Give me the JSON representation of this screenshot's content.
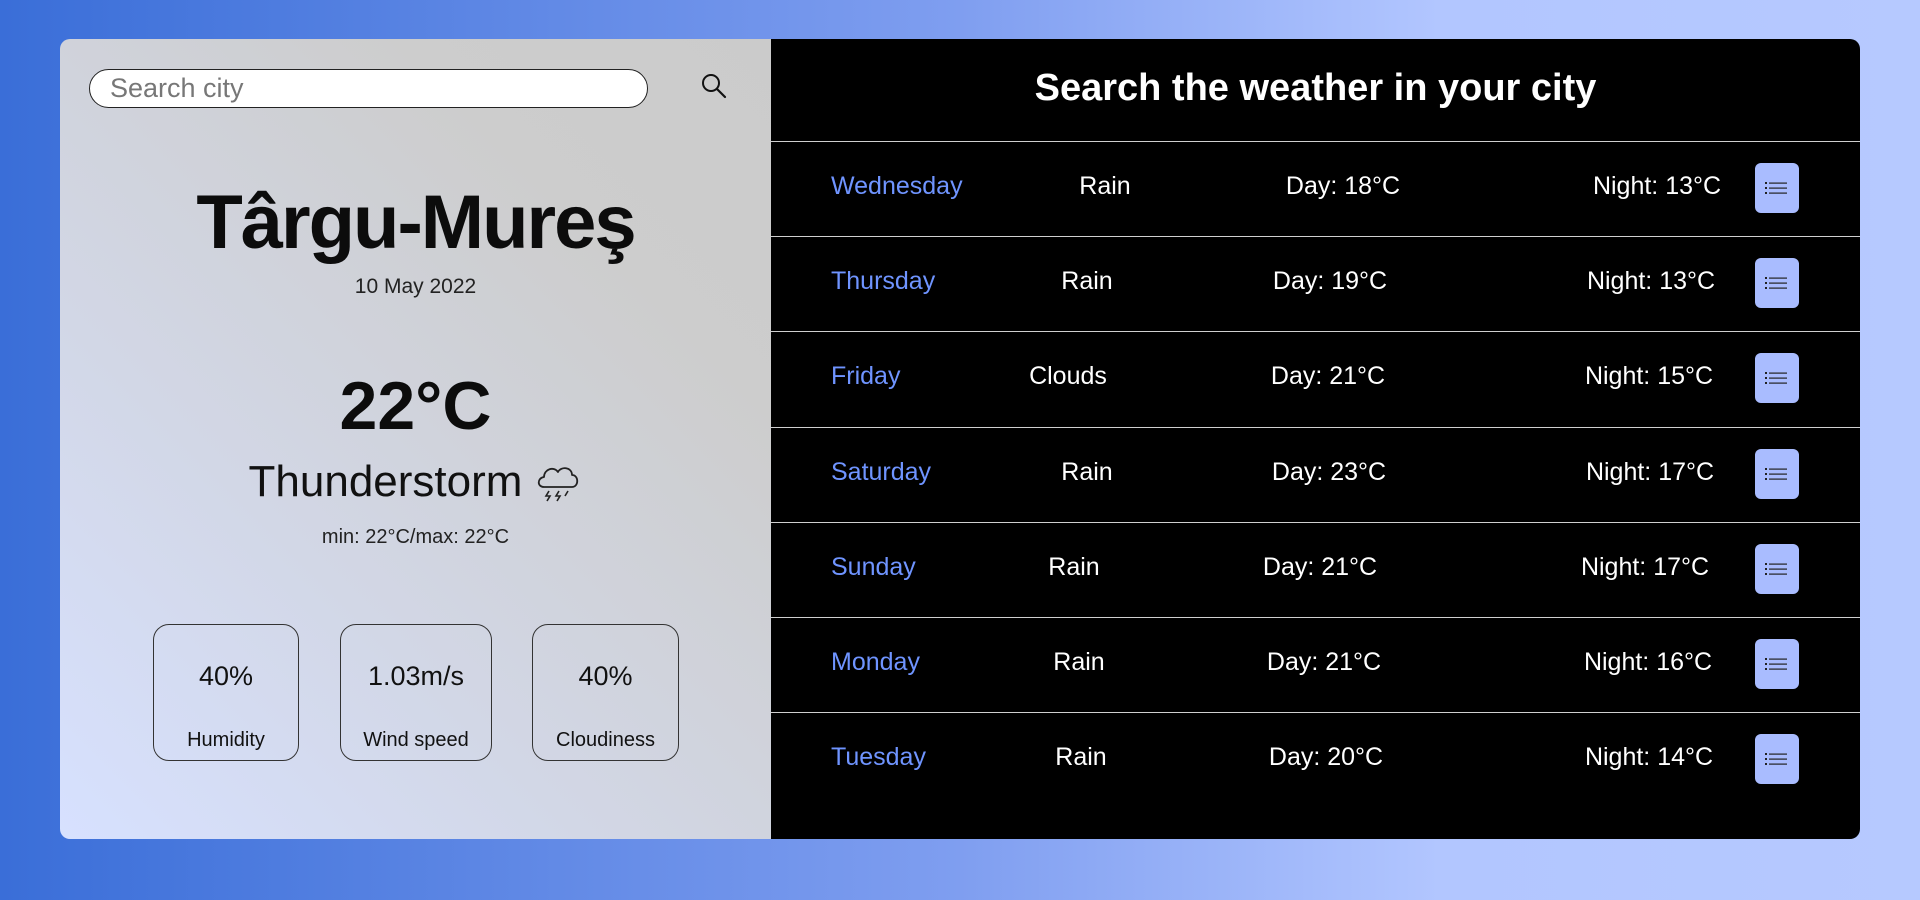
{
  "search": {
    "placeholder": "Search city",
    "value": ""
  },
  "current": {
    "city": "Târgu-Mureş",
    "date": "10 May 2022",
    "temperature": "22°C",
    "condition": "Thunderstorm",
    "condition_icon": "thunderstorm-cloud-icon",
    "minmax": "min: 22°C/max: 22°C"
  },
  "stats": [
    {
      "value": "40%",
      "label": "Humidity"
    },
    {
      "value": "1.03m/s",
      "label": "Wind speed"
    },
    {
      "value": "40%",
      "label": "Cloudiness"
    }
  ],
  "forecast": {
    "title": "Search the weather in your city",
    "days": [
      {
        "day": "Wednesday",
        "weather": "Rain",
        "day_temp": "Day: 18°C",
        "night_temp": "Night: 13°C"
      },
      {
        "day": "Thursday",
        "weather": "Rain",
        "day_temp": "Day: 19°C",
        "night_temp": "Night: 13°C"
      },
      {
        "day": "Friday",
        "weather": "Clouds",
        "day_temp": "Day: 21°C",
        "night_temp": "Night: 15°C"
      },
      {
        "day": "Saturday",
        "weather": "Rain",
        "day_temp": "Day: 23°C",
        "night_temp": "Night: 17°C"
      },
      {
        "day": "Sunday",
        "weather": "Rain",
        "day_temp": "Day: 21°C",
        "night_temp": "Night: 17°C"
      },
      {
        "day": "Monday",
        "weather": "Rain",
        "day_temp": "Day: 21°C",
        "night_temp": "Night: 16°C"
      },
      {
        "day": "Tuesday",
        "weather": "Rain",
        "day_temp": "Day: 20°C",
        "night_temp": "Night: 14°C"
      }
    ]
  },
  "colors": {
    "day_name": "#6f94ff",
    "detail_button": "#a9bcff",
    "panel_bg": "#000000"
  }
}
